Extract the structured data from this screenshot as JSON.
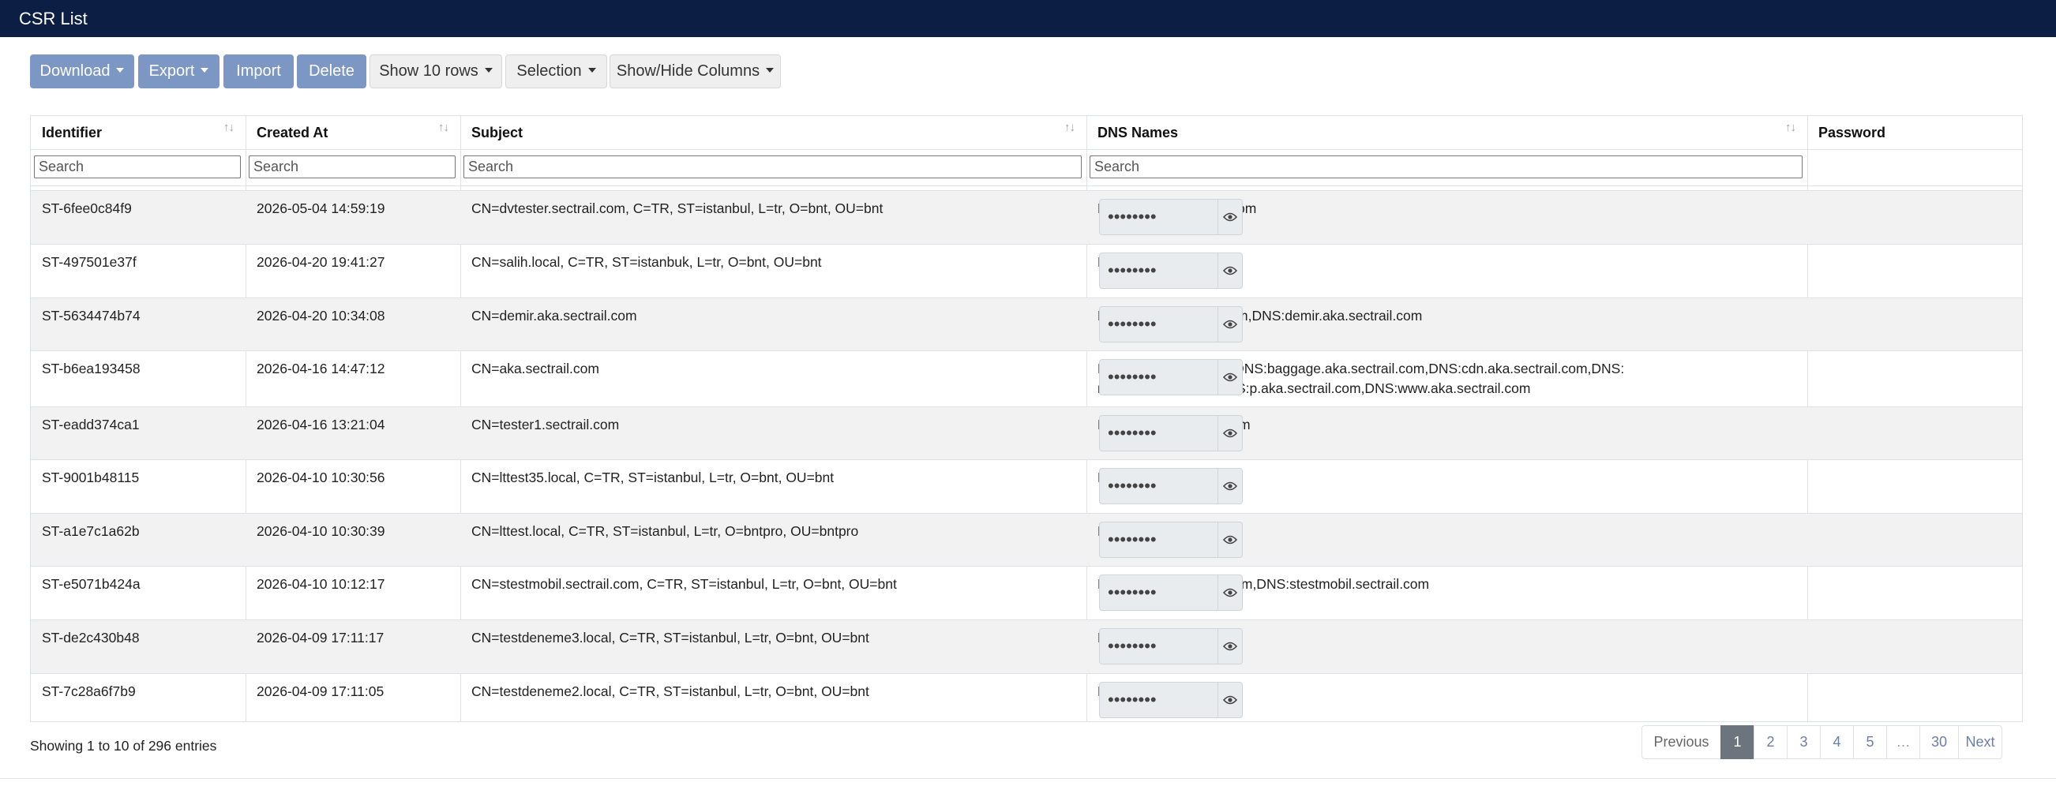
{
  "header": {
    "title": "CSR List"
  },
  "toolbar": {
    "download": "Download",
    "export": "Export",
    "import": "Import",
    "delete": "Delete",
    "show_rows": "Show 10 rows",
    "selection": "Selection",
    "show_hide": "Show/Hide Columns"
  },
  "table": {
    "columns": [
      "Identifier",
      "Created At",
      "Subject",
      "DNS Names",
      "Password"
    ],
    "search_placeholder": "Search",
    "rows": [
      {
        "identifier": "ST-6fee0c84f9",
        "created": "2026-05-04 14:59:19",
        "subject": "CN=dvtester.sectrail.com, C=TR, ST=istanbul, L=tr, O=bnt, OU=bnt",
        "dns": "DNS:dvtester.sectrail.com",
        "password": "••••••••"
      },
      {
        "identifier": "ST-497501e37f",
        "created": "2026-04-20 19:41:27",
        "subject": "CN=salih.local, C=TR, ST=istanbuk, L=tr, O=bnt, OU=bnt",
        "dns": "DNS:salih.local",
        "password": "••••••••"
      },
      {
        "identifier": "ST-5634474b74",
        "created": "2026-04-20 10:34:08",
        "subject": "CN=demir.aka.sectrail.com",
        "dns": "DNS:alj.aka.sectrail.com,DNS:demir.aka.sectrail.com",
        "password": "••••••••"
      },
      {
        "identifier": "ST-b6ea193458",
        "created": "2026-04-16 14:47:12",
        "subject": "CN=aka.sectrail.com",
        "dns": "DNS:aka.sectrail.com,DNS:baggage.aka.sectrail.com,DNS:cdn.aka.sectrail.com,DNS:m.aka.sectrail.com,DNS:p.aka.sectrail.com,DNS:www.aka.sectrail.com",
        "password": "••••••••"
      },
      {
        "identifier": "ST-eadd374ca1",
        "created": "2026-04-16 13:21:04",
        "subject": "CN=tester1.sectrail.com",
        "dns": "DNS:tester1.sectrail.com",
        "password": "••••••••"
      },
      {
        "identifier": "ST-9001b48115",
        "created": "2026-04-10 10:30:56",
        "subject": "CN=lttest35.local, C=TR, ST=istanbul, L=tr, O=bnt, OU=bnt",
        "dns": "DNS:lttest35.local",
        "password": "••••••••"
      },
      {
        "identifier": "ST-a1e7c1a62b",
        "created": "2026-04-10 10:30:39",
        "subject": "CN=lttest.local, C=TR, ST=istanbul, L=tr, O=bntpro, OU=bntpro",
        "dns": "DNS:lttest.local",
        "password": "••••••••"
      },
      {
        "identifier": "ST-e5071b424a",
        "created": "2026-04-10 10:12:17",
        "subject": "CN=stestmobil.sectrail.com, C=TR, ST=istanbul, L=tr, O=bnt, OU=bnt",
        "dns": "DNS:stest25.sectrail.com,DNS:stestmobil.sectrail.com",
        "password": "••••••••"
      },
      {
        "identifier": "ST-de2c430b48",
        "created": "2026-04-09 17:11:17",
        "subject": "CN=testdeneme3.local, C=TR, ST=istanbul, L=tr, O=bnt, OU=bnt",
        "dns": "DNS:testdeneme3.local",
        "password": "••••••••"
      },
      {
        "identifier": "ST-7c28a6f7b9",
        "created": "2026-04-09 17:11:05",
        "subject": "CN=testdeneme2.local, C=TR, ST=istanbul, L=tr, O=bnt, OU=bnt",
        "dns": "DNS:testdeneme2.local",
        "password": "••••••••"
      }
    ]
  },
  "footer": {
    "info": "Showing 1 to 10 of 296 entries",
    "pagination": [
      "Previous",
      "1",
      "2",
      "3",
      "4",
      "5",
      "…",
      "30",
      "Next"
    ],
    "active_page": "1"
  }
}
